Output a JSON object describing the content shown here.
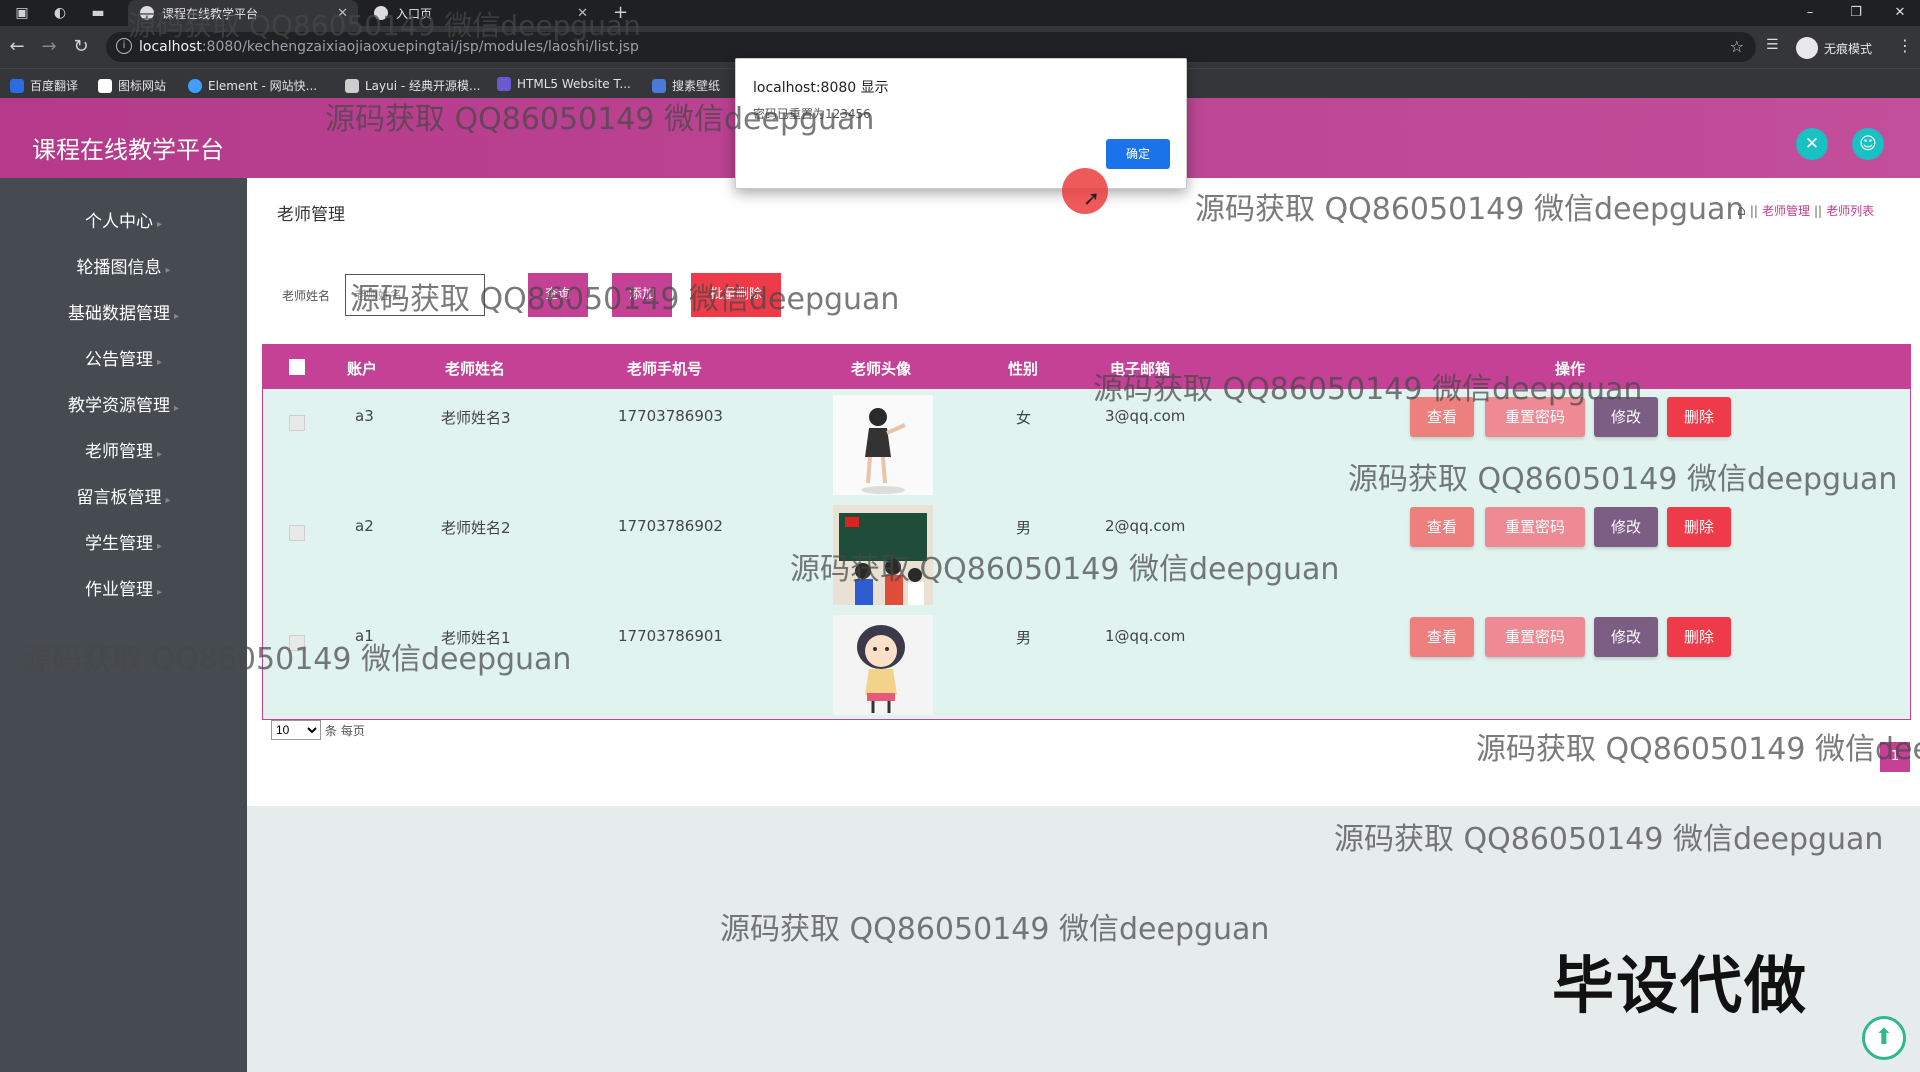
{
  "browser": {
    "tabs": [
      {
        "label": "课程在线教学平台"
      },
      {
        "label": "入口页"
      }
    ],
    "url_host": "localhost",
    "url_path": ":8080/kechengzaixiaojiaoxuepingtai/jsp/modules/laoshi/list.jsp",
    "incognito_label": "无痕模式",
    "bookmarks": [
      {
        "label": "百度翻译"
      },
      {
        "label": "图标网站"
      },
      {
        "label": "Element - 网站快..."
      },
      {
        "label": "Layui - 经典开源模..."
      },
      {
        "label": "HTML5 Website T..."
      },
      {
        "label": "搜素壁纸"
      }
    ]
  },
  "app": {
    "title": "课程在线教学平台"
  },
  "sidebar": {
    "items": [
      {
        "label": "个人中心"
      },
      {
        "label": "轮播图信息"
      },
      {
        "label": "基础数据管理"
      },
      {
        "label": "公告管理"
      },
      {
        "label": "教学资源管理"
      },
      {
        "label": "老师管理"
      },
      {
        "label": "留言板管理"
      },
      {
        "label": "学生管理"
      },
      {
        "label": "作业管理"
      }
    ]
  },
  "page": {
    "heading": "老师管理",
    "breadcrumb": [
      "老师管理",
      "老师列表"
    ]
  },
  "search": {
    "label": "老师姓名",
    "placeholder": "老师姓名",
    "query_label": "查询",
    "add_label": "添加",
    "delete_label": "批量删除"
  },
  "table": {
    "columns": [
      "账户",
      "老师姓名",
      "老师手机号",
      "老师头像",
      "性别",
      "电子邮箱",
      "操作"
    ],
    "rows": [
      {
        "account": "a3",
        "name": "老师姓名3",
        "phone": "17703786903",
        "gender": "女",
        "email": "3@qq.com"
      },
      {
        "account": "a2",
        "name": "老师姓名2",
        "phone": "17703786902",
        "gender": "男",
        "email": "2@qq.com"
      },
      {
        "account": "a1",
        "name": "老师姓名1",
        "phone": "17703786901",
        "gender": "男",
        "email": "1@qq.com"
      }
    ],
    "actions": {
      "view": "查看",
      "reset": "重置密码",
      "edit": "修改",
      "delete": "删除"
    }
  },
  "pager": {
    "page_size": "10",
    "per_page_label": "条 每页",
    "current_page": "1"
  },
  "dialog": {
    "title": "localhost:8080 显示",
    "message": "密码已重置为123456",
    "ok_label": "确定"
  },
  "watermark": {
    "text": "源码获取 QQ86050149 微信deepguan",
    "promo": "毕设代做"
  },
  "colors": {
    "brand": "#c44195",
    "sidebar": "#454b51",
    "danger": "#ef3b49",
    "accent": "#19c1c4"
  }
}
